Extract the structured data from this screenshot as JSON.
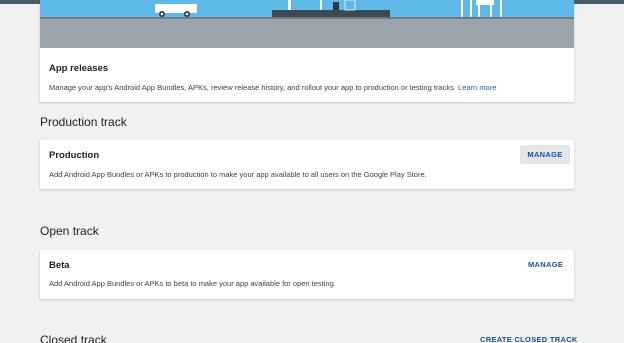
{
  "app_releases": {
    "title": "App releases",
    "description": "Manage your app's Android App Bundles, APKs, review release history, and rollout your app to production or testing tracks.",
    "learn_more": "Learn more"
  },
  "production_track": {
    "section_title": "Production track",
    "card_title": "Production",
    "description": "Add Android App Bundles or APKs to production to make your app available to all users on the Google Play Store.",
    "button": "MANAGE"
  },
  "open_track": {
    "section_title": "Open track",
    "card_title": "Beta",
    "description": "Add Android App Bundles or APKs to beta to make your app available for open testing.",
    "button": "MANAGE"
  },
  "closed_track": {
    "section_title": "Closed track",
    "button": "CREATE CLOSED TRACK"
  },
  "colors": {
    "accent": "#1565c0",
    "banner_sky": "#5eb8e8",
    "banner_ground": "#9aa4ab",
    "page_bg": "#f1f1f1"
  }
}
